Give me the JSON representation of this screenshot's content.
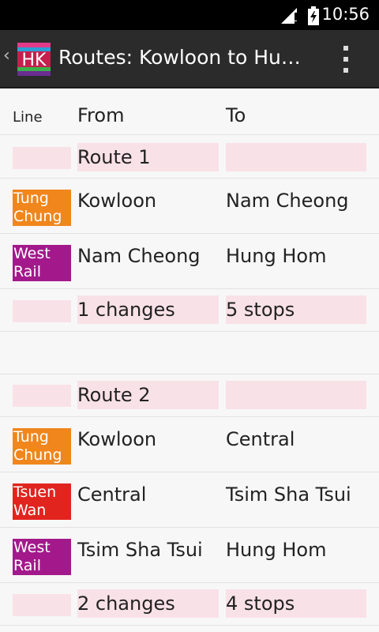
{
  "status": {
    "time": "10:56"
  },
  "actionbar": {
    "back_glyph": "‹",
    "app_icon_text": "HK",
    "title": "Routes: Kowloon to Hun…",
    "menu_icon": "overflow-menu-icon"
  },
  "table": {
    "headers": {
      "line": "Line",
      "from": "From",
      "to": "To"
    },
    "routes": [
      {
        "label": "Route 1",
        "legs": [
          {
            "line": "Tung Chung",
            "color": "#f0861c",
            "from": "Kowloon",
            "to": "Nam Cheong"
          },
          {
            "line": "West Rail",
            "color": "#a3198b",
            "from": "Nam Cheong",
            "to": "Hung Hom"
          }
        ],
        "changes": "1 changes",
        "stops": "5 stops"
      },
      {
        "label": "Route 2",
        "legs": [
          {
            "line": "Tung Chung",
            "color": "#f0861c",
            "from": "Kowloon",
            "to": "Central"
          },
          {
            "line": "Tsuen Wan",
            "color": "#e2241f",
            "from": "Central",
            "to": "Tsim Sha Tsui"
          },
          {
            "line": "West Rail",
            "color": "#a3198b",
            "from": "Tsim Sha Tsui",
            "to": "Hung Hom"
          }
        ],
        "changes": "2 changes",
        "stops": "4 stops"
      }
    ]
  },
  "colors": {
    "pink_cell": "#f9e1e8",
    "actionbar": "#2b2b2b"
  }
}
